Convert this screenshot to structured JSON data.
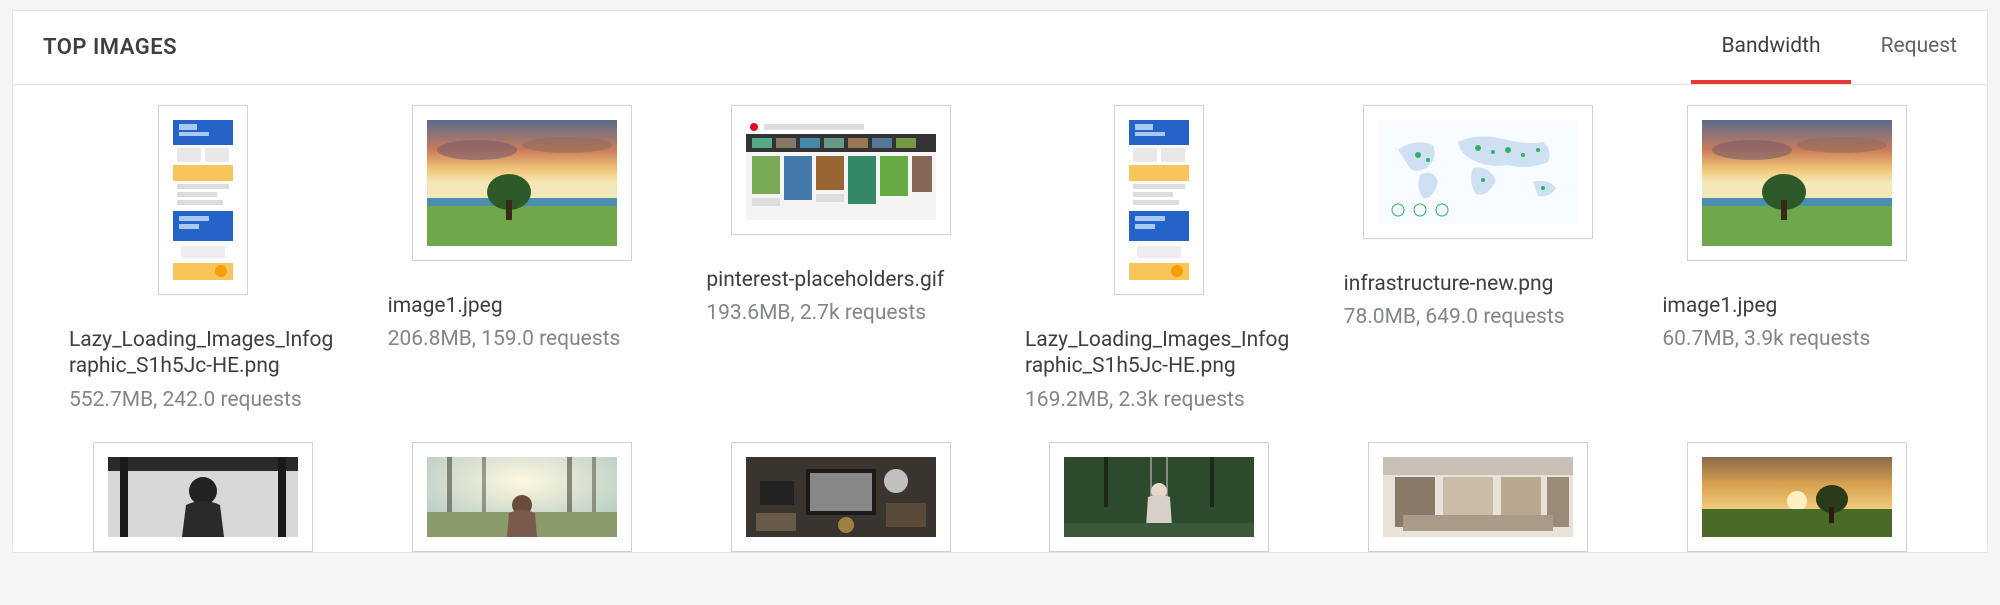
{
  "header": {
    "title": "TOP IMAGES",
    "tabs": [
      {
        "label": "Bandwidth",
        "active": true
      },
      {
        "label": "Request",
        "active": false
      }
    ]
  },
  "cards_row1": [
    {
      "filename": "Lazy_Loading_Images_Infographic_S1h5Jc-HE.png",
      "stats": "552.7MB, 242.0 requests",
      "thumb": "tall-page"
    },
    {
      "filename": "image1.jpeg",
      "stats": "206.8MB, 159.0 requests",
      "thumb": "sunset-tree"
    },
    {
      "filename": "pinterest-placeholders.gif",
      "stats": "193.6MB, 2.7k requests",
      "thumb": "pinterest"
    },
    {
      "filename": "Lazy_Loading_Images_Infographic_S1h5Jc-HE.png",
      "stats": "169.2MB, 2.3k requests",
      "thumb": "tall-page"
    },
    {
      "filename": "infrastructure-new.png",
      "stats": "78.0MB, 649.0 requests",
      "thumb": "world-map"
    },
    {
      "filename": "image1.jpeg",
      "stats": "60.7MB, 3.9k requests",
      "thumb": "sunset-tree"
    }
  ],
  "cards_row2": [
    {
      "thumb": "bw-child"
    },
    {
      "thumb": "girl-sun"
    },
    {
      "thumb": "desk"
    },
    {
      "thumb": "swing"
    },
    {
      "thumb": "shop"
    },
    {
      "thumb": "sunset-field"
    }
  ]
}
